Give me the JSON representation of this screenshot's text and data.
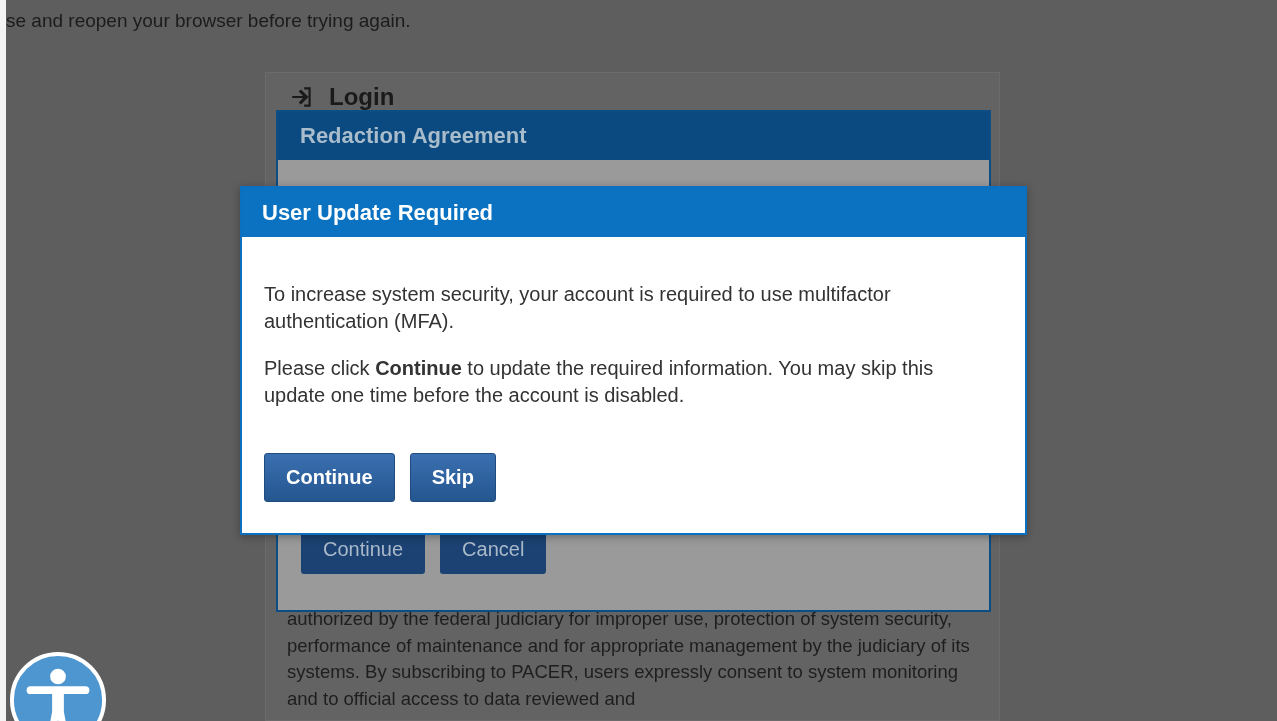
{
  "page": {
    "notice_text": "se and reopen your browser before trying again."
  },
  "login_card": {
    "title": "Login",
    "body_text": "authorized by the federal judiciary for improper use, protection of system security, performance of maintenance and for appropriate management by the judiciary of its systems. By subscribing to PACER, users expressly consent to system monitoring and to official access to data reviewed and"
  },
  "redaction_dialog": {
    "title": "Redaction Agreement",
    "buttons": [
      "Continue",
      "Cancel"
    ]
  },
  "update_dialog": {
    "title": "User Update Required",
    "paragraphs": [
      "To increase system security, your account is required to use multifactor authentication (MFA).",
      "Please click **Continue** to update the required information. You may skip this update one time before the account is disabled."
    ],
    "buttons": [
      "Continue",
      "Skip"
    ]
  }
}
